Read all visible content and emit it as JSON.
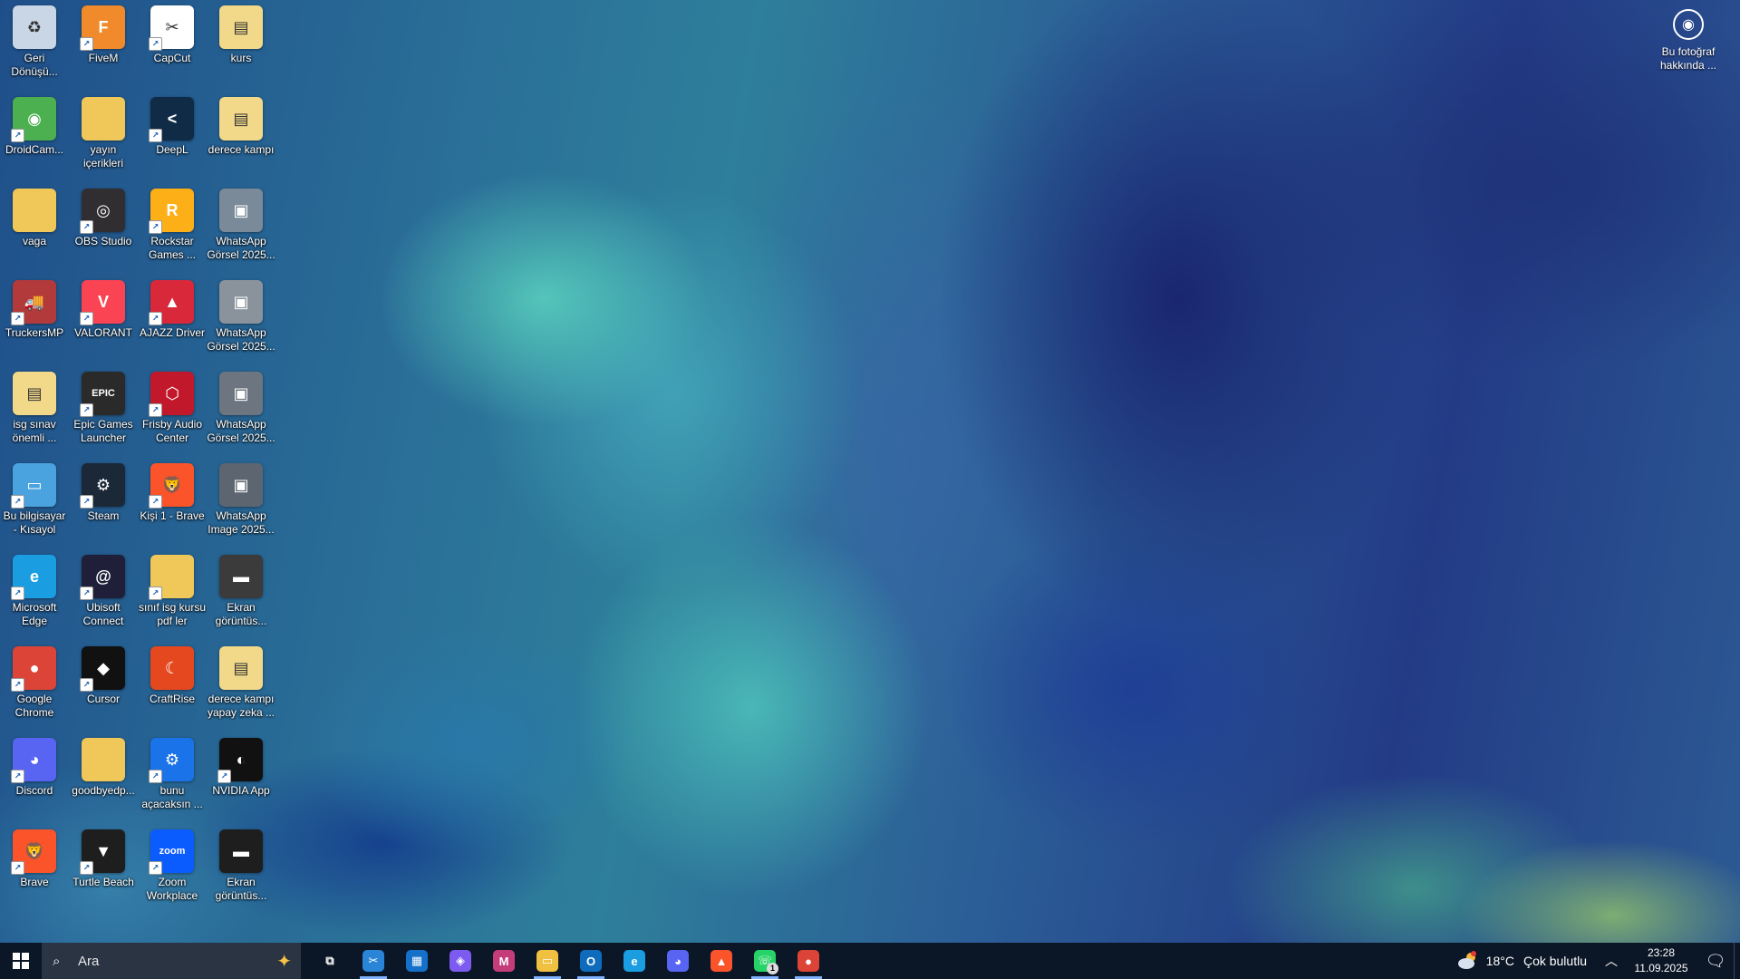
{
  "desktop": {
    "icons": [
      {
        "label": "Geri Dönüşü...",
        "name": "recycle-bin-icon",
        "color": "#c8d6e6",
        "glyph": "♻",
        "shortcut": false
      },
      {
        "label": "FiveM",
        "name": "fivem-icon",
        "color": "#f08a2b",
        "glyph": "F",
        "shortcut": true
      },
      {
        "label": "CapCut",
        "name": "capcut-icon",
        "color": "#ffffff",
        "glyph": "✂",
        "shortcut": true
      },
      {
        "label": "kurs",
        "name": "pdf-file-icon",
        "color": "#f2d98a",
        "glyph": "▤",
        "shortcut": false
      },
      {
        "label": "DroidCam...",
        "name": "droidcam-icon",
        "color": "#4caf50",
        "glyph": "◉",
        "shortcut": true
      },
      {
        "label": "yayın içerikleri",
        "name": "folder-icon",
        "color": "#f0c85a",
        "glyph": "",
        "shortcut": false
      },
      {
        "label": "DeepL",
        "name": "deepl-icon",
        "color": "#0f2b46",
        "glyph": "<",
        "shortcut": true
      },
      {
        "label": "derece kampı",
        "name": "pdf-file-icon",
        "color": "#f2d98a",
        "glyph": "▤",
        "shortcut": false
      },
      {
        "label": "vaga",
        "name": "folder-icon",
        "color": "#f0c85a",
        "glyph": "",
        "shortcut": false
      },
      {
        "label": "OBS Studio",
        "name": "obs-studio-icon",
        "color": "#302e31",
        "glyph": "◎",
        "shortcut": true
      },
      {
        "label": "Rockstar Games ...",
        "name": "rockstar-games-icon",
        "color": "#fcaf17",
        "glyph": "R",
        "shortcut": true
      },
      {
        "label": "WhatsApp Görsel 2025...",
        "name": "image-file-icon",
        "color": "#7a8a99",
        "glyph": "▣",
        "shortcut": false
      },
      {
        "label": "TruckersMP",
        "name": "truckersmp-icon",
        "color": "#b23a3a",
        "glyph": "🚚",
        "shortcut": true
      },
      {
        "label": "VALORANT",
        "name": "valorant-icon",
        "color": "#fa4454",
        "glyph": "V",
        "shortcut": true
      },
      {
        "label": "AJAZZ Driver",
        "name": "ajazz-driver-icon",
        "color": "#d8283a",
        "glyph": "▲",
        "shortcut": true
      },
      {
        "label": "WhatsApp Görsel 2025...",
        "name": "image-file-icon",
        "color": "#8a939c",
        "glyph": "▣",
        "shortcut": false
      },
      {
        "label": "isg sınav önemli ...",
        "name": "pdf-file-icon",
        "color": "#f2d98a",
        "glyph": "▤",
        "shortcut": false
      },
      {
        "label": "Epic Games Launcher",
        "name": "epic-games-icon",
        "color": "#2a2a2a",
        "glyph": "EPIC",
        "shortcut": true
      },
      {
        "label": "Frisby Audio Center",
        "name": "frisby-audio-icon",
        "color": "#c2182b",
        "glyph": "⬡",
        "shortcut": true
      },
      {
        "label": "WhatsApp Görsel 2025...",
        "name": "image-file-icon",
        "color": "#6c7580",
        "glyph": "▣",
        "shortcut": false
      },
      {
        "label": "Bu bilgisayar - Kısayol",
        "name": "this-pc-icon",
        "color": "#4aa3df",
        "glyph": "▭",
        "shortcut": true
      },
      {
        "label": "Steam",
        "name": "steam-icon",
        "color": "#1b2838",
        "glyph": "⚙",
        "shortcut": true
      },
      {
        "label": "Kişi 1 - Brave",
        "name": "brave-profile-icon",
        "color": "#fb542b",
        "glyph": "🦁",
        "shortcut": true
      },
      {
        "label": "WhatsApp Image 2025...",
        "name": "image-file-icon",
        "color": "#5d6670",
        "glyph": "▣",
        "shortcut": false
      },
      {
        "label": "Microsoft Edge",
        "name": "microsoft-edge-icon",
        "color": "#1b9de2",
        "glyph": "e",
        "shortcut": true
      },
      {
        "label": "Ubisoft Connect",
        "name": "ubisoft-connect-icon",
        "color": "#1f1f3a",
        "glyph": "@",
        "shortcut": true
      },
      {
        "label": "sınıf isg kursu pdf ler",
        "name": "folder-icon",
        "color": "#f0c85a",
        "glyph": "",
        "shortcut": true
      },
      {
        "label": "Ekran görüntüs...",
        "name": "screenshot-file-icon",
        "color": "#3b3b3b",
        "glyph": "▬",
        "shortcut": false
      },
      {
        "label": "Google Chrome",
        "name": "google-chrome-icon",
        "color": "#db4437",
        "glyph": "●",
        "shortcut": true
      },
      {
        "label": "Cursor",
        "name": "cursor-icon",
        "color": "#111111",
        "glyph": "◆",
        "shortcut": true
      },
      {
        "label": "CraftRise",
        "name": "craftrise-icon",
        "color": "#e5471e",
        "glyph": "☾",
        "shortcut": false
      },
      {
        "label": "derece kampı yapay zeka ...",
        "name": "pdf-file-icon",
        "color": "#f2d98a",
        "glyph": "▤",
        "shortcut": false
      },
      {
        "label": "Discord",
        "name": "discord-icon",
        "color": "#5865f2",
        "glyph": "◕",
        "shortcut": true
      },
      {
        "label": "goodbyedp...",
        "name": "folder-icon",
        "color": "#f0c85a",
        "glyph": "",
        "shortcut": false
      },
      {
        "label": "bunu açacaksın ...",
        "name": "settings-icon",
        "color": "#1a73e8",
        "glyph": "⚙",
        "shortcut": true
      },
      {
        "label": "NVIDIA App",
        "name": "nvidia-app-icon",
        "color": "#111111",
        "glyph": "◐",
        "shortcut": true
      },
      {
        "label": "Brave",
        "name": "brave-icon",
        "color": "#fb542b",
        "glyph": "🦁",
        "shortcut": true
      },
      {
        "label": "Turtle Beach",
        "name": "turtle-beach-icon",
        "color": "#1e1e1e",
        "glyph": "▼",
        "shortcut": true
      },
      {
        "label": "Zoom Workplace",
        "name": "zoom-icon",
        "color": "#0b5cff",
        "glyph": "zoom",
        "shortcut": true
      },
      {
        "label": "Ekran görüntüs...",
        "name": "screenshot-file-icon",
        "color": "#1e1e1e",
        "glyph": "▬",
        "shortcut": false
      }
    ],
    "about_photo": {
      "label": "Bu fotoğraf hakkında ..."
    }
  },
  "taskbar": {
    "search_placeholder": "Ara",
    "pinned": [
      {
        "name": "task-view-icon",
        "color": "transparent",
        "glyph": "⧉",
        "active": false
      },
      {
        "name": "snipping-tool-icon",
        "color": "#2a84d8",
        "glyph": "✂",
        "active": true
      },
      {
        "name": "microsoft-store-icon",
        "color": "#1470c8",
        "glyph": "▦",
        "active": false
      },
      {
        "name": "copilot-icon",
        "color": "#7d5af0",
        "glyph": "◈",
        "active": false
      },
      {
        "name": "microsoft-365-icon",
        "color": "#c43c7a",
        "glyph": "M",
        "active": false
      },
      {
        "name": "file-explorer-icon",
        "color": "#f0c040",
        "glyph": "▭",
        "active": true
      },
      {
        "name": "outlook-icon",
        "color": "#0f6cbd",
        "glyph": "O",
        "active": true
      },
      {
        "name": "edge-taskbar-icon",
        "color": "#1b9de2",
        "glyph": "e",
        "active": false
      },
      {
        "name": "messenger-icon",
        "color": "#5865f2",
        "glyph": "◕",
        "active": false
      },
      {
        "name": "brave-taskbar-icon",
        "color": "#fb542b",
        "glyph": "▲",
        "active": false
      },
      {
        "name": "whatsapp-icon",
        "color": "#25d366",
        "glyph": "☏",
        "active": true,
        "badge": "1"
      },
      {
        "name": "chrome-taskbar-icon",
        "color": "#db4437",
        "glyph": "●",
        "active": true
      }
    ],
    "weather": {
      "temp": "18°C",
      "condition": "Çok bulutlu"
    },
    "clock": {
      "time": "23:28",
      "date": "11.09.2025"
    }
  }
}
